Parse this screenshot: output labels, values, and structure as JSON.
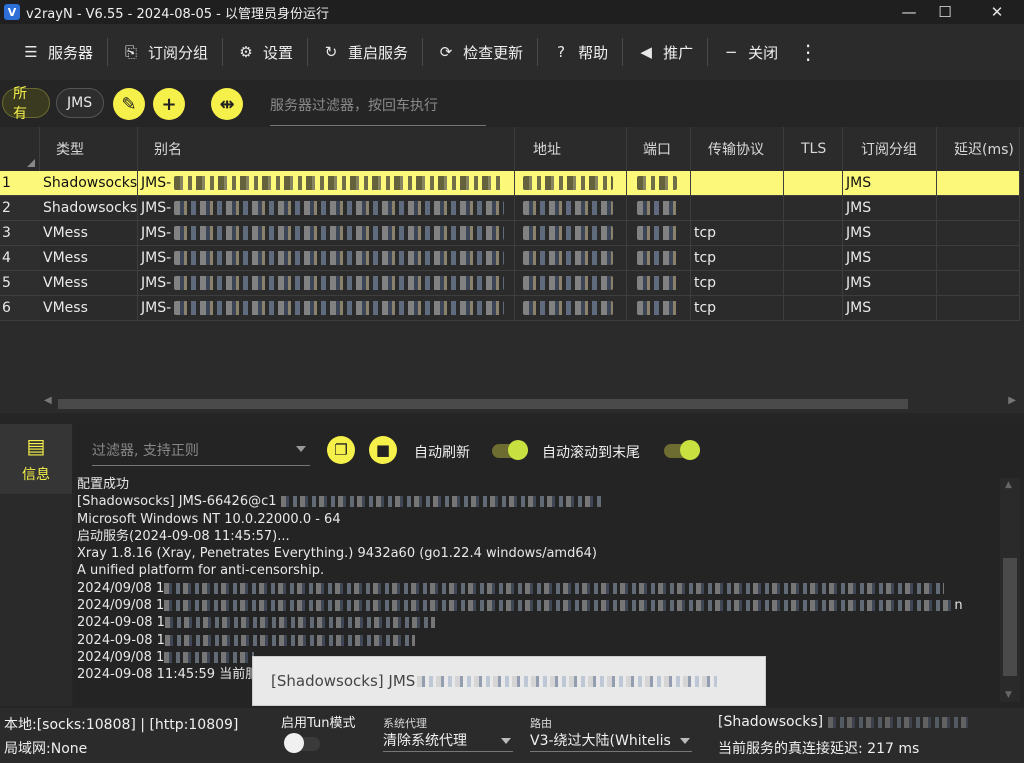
{
  "window": {
    "title": "v2rayN - V6.55 - 2024-08-05 - 以管理员身份运行",
    "logo": "V",
    "min": "—",
    "max": "☐",
    "close": "✕"
  },
  "toolbar": {
    "servers": "服务器",
    "subscription": "订阅分组",
    "settings": "设置",
    "restart": "重启服务",
    "check_update": "检查更新",
    "help": "帮助",
    "promote": "推广",
    "close": "关闭",
    "more": "⋮"
  },
  "filter": {
    "all": "所有",
    "jms": "JMS",
    "placeholder": "服务器过滤器，按回车执行"
  },
  "grid": {
    "headers": {
      "type": "类型",
      "alias": "别名",
      "address": "地址",
      "port": "端口",
      "transport": "传输协议",
      "tls": "TLS",
      "sub": "订阅分组",
      "delay": "延迟(ms)"
    },
    "rows": [
      {
        "num": "1",
        "type": "Shadowsocks",
        "alias": "JMS-",
        "transport": "",
        "sub": "JMS"
      },
      {
        "num": "2",
        "type": "Shadowsocks",
        "alias": "JMS-",
        "transport": "",
        "sub": "JMS"
      },
      {
        "num": "3",
        "type": "VMess",
        "alias": "JMS-",
        "transport": "tcp",
        "sub": "JMS"
      },
      {
        "num": "4",
        "type": "VMess",
        "alias": "JMS-",
        "transport": "tcp",
        "sub": "JMS"
      },
      {
        "num": "5",
        "type": "VMess",
        "alias": "JMS-",
        "transport": "tcp",
        "sub": "JMS"
      },
      {
        "num": "6",
        "type": "VMess",
        "alias": "JMS-",
        "transport": "tcp",
        "sub": "JMS"
      }
    ]
  },
  "sidebar": {
    "info": "信息"
  },
  "log": {
    "filter_placeholder": "过滤器, 支持正则",
    "auto_refresh": "自动刷新",
    "auto_scroll": "自动滚动到末尾",
    "lines": [
      "配置成功",
      "[Shadowsocks] JMS-66426@c1",
      "Microsoft Windows NT 10.0.22000.0 - 64",
      "启动服务(2024-09-08 11:45:57)...",
      "Xray 1.8.16 (Xray, Penetrates Everything.) 9432a60 (go1.22.4 windows/amd64)",
      "A unified platform for anti-censorship.",
      "2024/09/08 1",
      "2024/09/08 1",
      "2024-09-08 1",
      "2024-09-08 1",
      "2024/09/08 1",
      "2024-09-08 11:45:59 当前服"
    ],
    "line_tail_n": "n"
  },
  "toast": {
    "text": "[Shadowsocks] JMS"
  },
  "status": {
    "local": "本地:[socks:10808] | [http:10809]",
    "lan": "局域网:None",
    "tun_label": "启用Tun模式",
    "sysproxy_label": "系统代理",
    "sysproxy_value": "清除系统代理",
    "route_label": "路由",
    "route_value": "V3-绕过大陆(Whitelis",
    "current_server": "[Shadowsocks]",
    "latency": "当前服务的真连接延迟: 217 ms"
  },
  "colors": {
    "accent": "#f5f04a",
    "selected_row": "#fbf87a",
    "background": "#252525"
  }
}
